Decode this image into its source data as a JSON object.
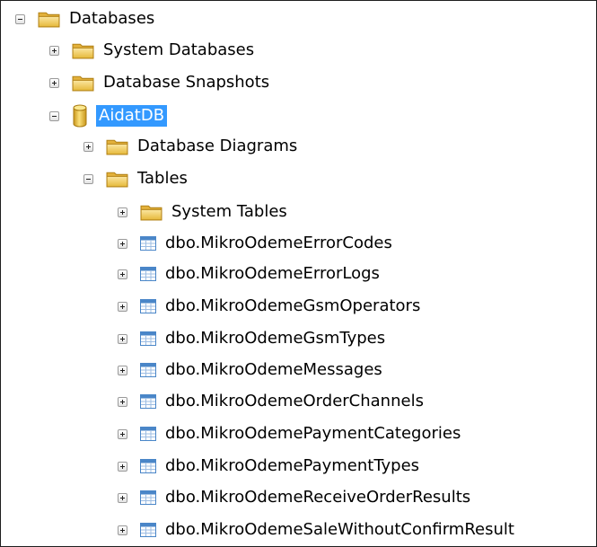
{
  "tree": {
    "databases_label": "Databases",
    "system_databases_label": "System Databases",
    "database_snapshots_label": "Database Snapshots",
    "aidat_db_label": "AidatDB",
    "database_diagrams_label": "Database Diagrams",
    "tables_label": "Tables",
    "system_tables_label": "System Tables",
    "tables": [
      "dbo.MikroOdemeErrorCodes",
      "dbo.MikroOdemeErrorLogs",
      "dbo.MikroOdemeGsmOperators",
      "dbo.MikroOdemeGsmTypes",
      "dbo.MikroOdemeMessages",
      "dbo.MikroOdemeOrderChannels",
      "dbo.MikroOdemePaymentCategories",
      "dbo.MikroOdemePaymentTypes",
      "dbo.MikroOdemeReceiveOrderResults",
      "dbo.MikroOdemeSaleWithoutConfirmResult"
    ]
  },
  "colors": {
    "selection": "#3399ff",
    "folder": "#f2c84b",
    "database": "#f0c430",
    "table_header": "#4a86c8"
  },
  "icons": {
    "expander_expanded": "minus-box",
    "expander_collapsed": "plus-box",
    "folder": "folder-icon",
    "database": "database-cylinder-icon",
    "table": "table-grid-icon"
  }
}
